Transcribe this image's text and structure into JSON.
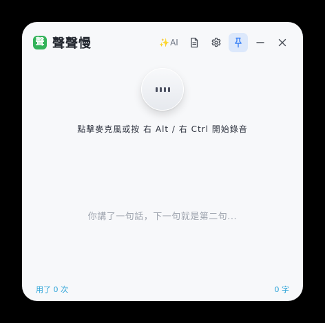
{
  "app": {
    "icon_char": "聲",
    "title": "聲聲慢"
  },
  "toolbar": {
    "ai_spark": "✨",
    "ai_label": "AI"
  },
  "main": {
    "hint": "點擊麥克風或按 右 Alt / 右 Ctrl 開始錄音",
    "placeholder": "你講了一句話，下一句就是第二句..."
  },
  "footer": {
    "usage": "用了 0 次",
    "char_count": "0 字"
  },
  "colors": {
    "accent": "#3b82f6",
    "brand": "#34b35a",
    "footer_text": "#2fa4d8"
  }
}
